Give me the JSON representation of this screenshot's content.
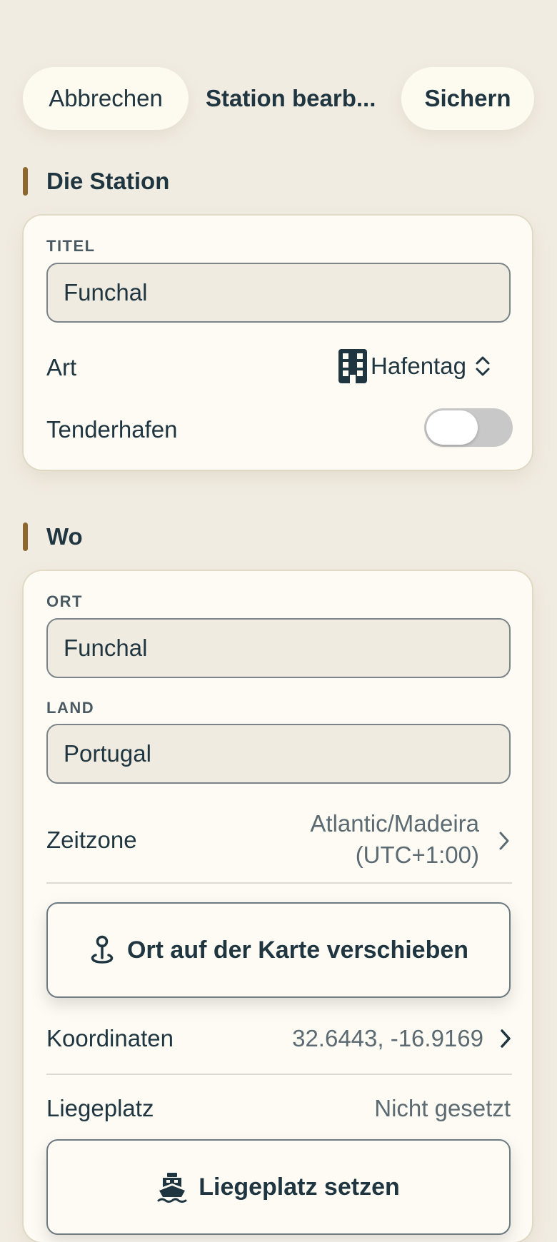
{
  "header": {
    "cancel_label": "Abbrechen",
    "title": "Station bearb...",
    "save_label": "Sichern"
  },
  "section_station": {
    "heading": "Die Station",
    "title_label": "TITEL",
    "title_value": "Funchal",
    "type_label": "Art",
    "type_icon": "building-icon",
    "type_value": "Hafentag",
    "tender_label": "Tenderhafen",
    "tender_on": false
  },
  "section_where": {
    "heading": "Wo",
    "city_label": "ORT",
    "city_value": "Funchal",
    "country_label": "LAND",
    "country_value": "Portugal",
    "timezone_label": "Zeitzone",
    "timezone_value_line1": "Atlantic/Madeira",
    "timezone_value_line2": "(UTC+1:00)",
    "move_on_map_label": "Ort auf der Karte verschieben",
    "coordinates_label": "Koordinaten",
    "coordinates_value": "32.6443, -16.9169",
    "berth_label": "Liegeplatz",
    "berth_value": "Nicht gesetzt",
    "set_berth_label": "Liegeplatz setzen"
  },
  "colors": {
    "background": "#f1ece2",
    "card": "#fdfbf4",
    "accent_bar": "#8d6630",
    "text": "#1f3540"
  }
}
